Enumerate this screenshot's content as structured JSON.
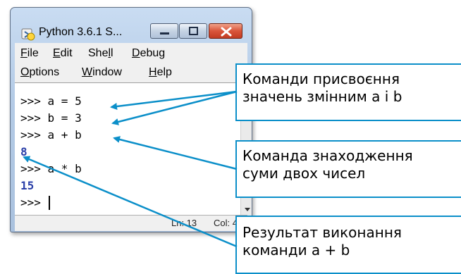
{
  "window": {
    "title": "Python 3.6.1 S...",
    "menus": [
      {
        "underline": "F",
        "rest": "ile"
      },
      {
        "underline": "E",
        "rest": "dit"
      },
      {
        "pre": "She",
        "underline": "l",
        "rest": "l"
      },
      {
        "underline": "D",
        "rest": "ebug"
      },
      {
        "underline": "O",
        "rest": "ptions"
      },
      {
        "underline": "W",
        "rest": "indow"
      },
      {
        "underline": "H",
        "rest": "elp"
      }
    ]
  },
  "shell": {
    "lines": [
      ">>> a = 5",
      ">>> b = 3",
      ">>> a + b",
      "8",
      ">>> a * b",
      "15",
      ">>> "
    ]
  },
  "status": {
    "line": "Ln: 13",
    "col": "Col: 4"
  },
  "callouts": [
    {
      "line1": "Команди присвоєння",
      "line2": "значень змінним a i b"
    },
    {
      "line1": "Команда знаходження",
      "line2": "суми двох чисел"
    },
    {
      "line1": "Результат виконання",
      "line2": "команди a + b"
    }
  ],
  "colors": {
    "arrow": "#0b8fc9",
    "output": "#2a3fa8"
  }
}
